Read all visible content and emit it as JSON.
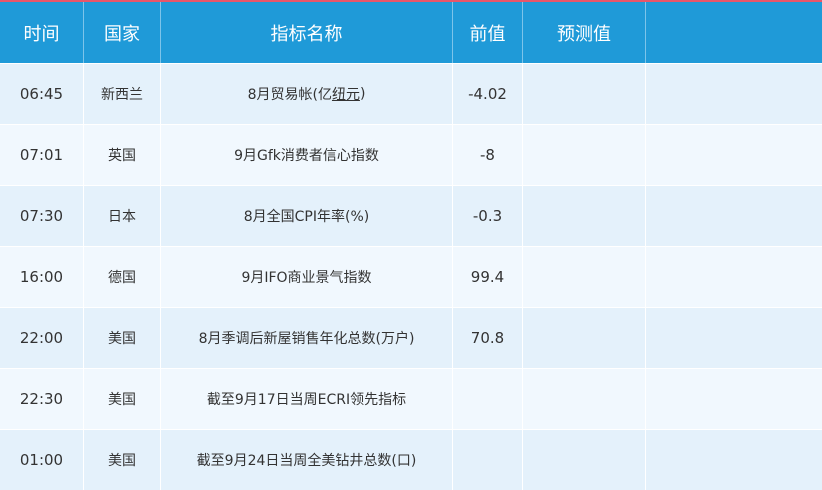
{
  "header": {
    "time": "时间",
    "country": "国家",
    "indicator": "指标名称",
    "previous": "前值",
    "forecast": "预测值",
    "extra": ""
  },
  "rows": [
    {
      "time": "06:45",
      "country": "新西兰",
      "indicator_prefix": "8月贸易帐(亿",
      "indicator_link": "纽元",
      "indicator_suffix": ")",
      "previous": "-4.02",
      "forecast": ""
    },
    {
      "time": "07:01",
      "country": "英国",
      "indicator": "9月Gfk消费者信心指数",
      "previous": "-8",
      "forecast": ""
    },
    {
      "time": "07:30",
      "country": "日本",
      "indicator": "8月全国CPI年率(%)",
      "previous": "-0.3",
      "forecast": ""
    },
    {
      "time": "16:00",
      "country": "德国",
      "indicator": "9月IFO商业景气指数",
      "previous": "99.4",
      "forecast": ""
    },
    {
      "time": "22:00",
      "country": "美国",
      "indicator": "8月季调后新屋销售年化总数(万户)",
      "previous": "70.8",
      "forecast": ""
    },
    {
      "time": "22:30",
      "country": "美国",
      "indicator": "截至9月17日当周ECRI领先指标",
      "previous": "",
      "forecast": ""
    },
    {
      "time": "01:00",
      "country": "美国",
      "indicator": "截至9月24日当周全美钻井总数(口)",
      "previous": "",
      "forecast": ""
    }
  ],
  "colors": {
    "header_bg": "#1f9ad8",
    "row_odd": "#e4f1fb",
    "row_even": "#f1f8fe",
    "top_border": "#e9566a"
  }
}
